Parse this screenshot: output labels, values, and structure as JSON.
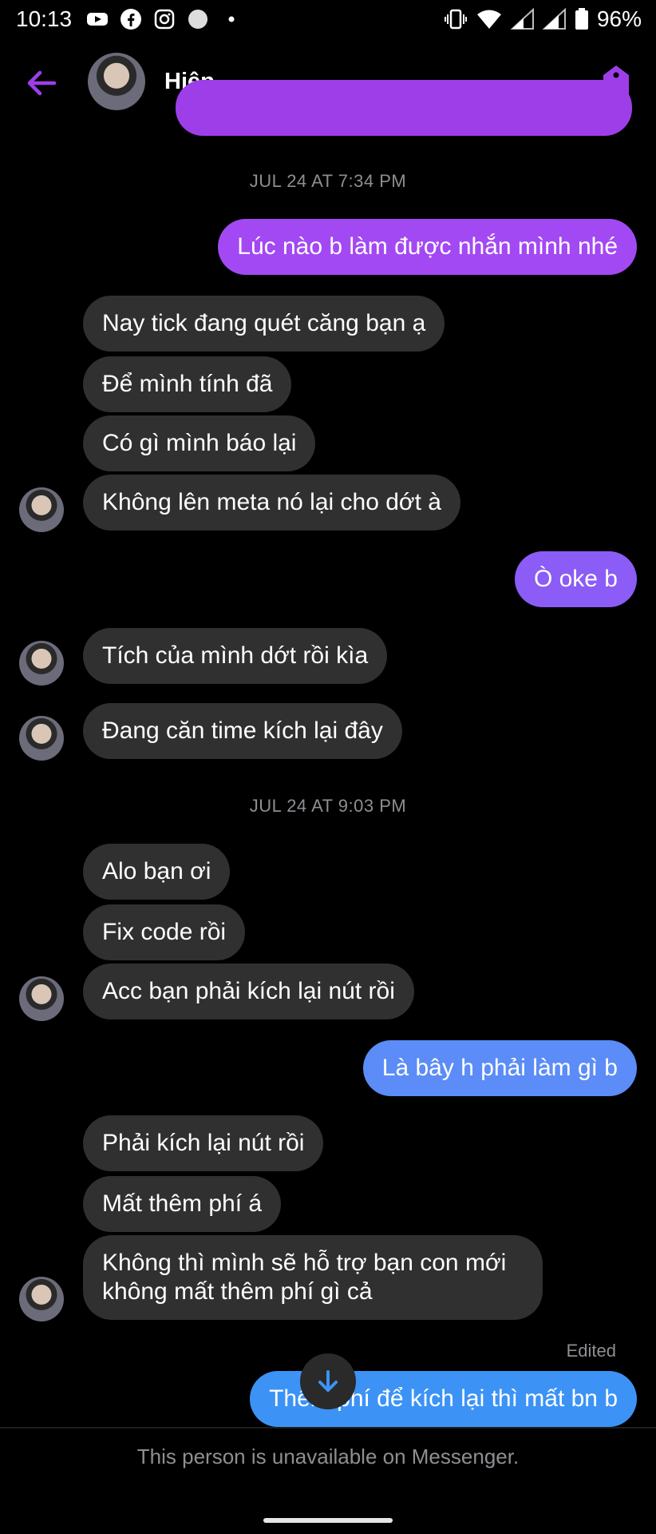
{
  "status_bar": {
    "time": "10:13",
    "battery": "96%",
    "app_icons": [
      "youtube-icon",
      "facebook-icon",
      "instagram-icon",
      "circle-icon",
      "dot-icon"
    ],
    "system_icons": [
      "vibrate-icon",
      "wifi-icon",
      "signal-icon",
      "signal-icon",
      "battery-icon"
    ]
  },
  "header": {
    "contact_name": "Hiệp",
    "accent_color": "#9e3ee9"
  },
  "conversation": {
    "timestamps": [
      "JUL 24 AT 7:34 PM",
      "JUL 24 AT 9:03 PM"
    ],
    "messages": [
      {
        "from": "me",
        "text": "Lúc nào b làm được nhắn mình nhé"
      },
      {
        "from": "them",
        "text": "Nay tick đang quét căng bạn ạ"
      },
      {
        "from": "them",
        "text": "Để mình tính đã"
      },
      {
        "from": "them",
        "text": "Có gì mình báo lại"
      },
      {
        "from": "them",
        "text": "Không lên meta nó lại cho dớt à"
      },
      {
        "from": "me",
        "text": "Ò oke b"
      },
      {
        "from": "them",
        "text": "Tích của mình dớt rồi kìa"
      },
      {
        "from": "them",
        "text": "Đang căn time kích lại đây"
      },
      {
        "from": "them",
        "text": "Alo bạn ơi"
      },
      {
        "from": "them",
        "text": "Fix code rồi"
      },
      {
        "from": "them",
        "text": "Acc bạn phải kích lại nút rồi"
      },
      {
        "from": "me",
        "text": "Là bây h phải làm gì b"
      },
      {
        "from": "them",
        "text": "Phải kích lại nút rồi"
      },
      {
        "from": "them",
        "text": "Mất thêm phí á"
      },
      {
        "from": "them",
        "text": "Không thì mình sẽ hỗ trợ bạn con mới không mất thêm phí gì cả"
      },
      {
        "from": "me",
        "text": "Thêm phí để kích lại thì mất bn b"
      }
    ],
    "edited_label": "Edited"
  },
  "footer": {
    "unavailable_text": "This person is unavailable on Messenger."
  },
  "colors": {
    "background": "#000000",
    "incoming_bubble": "#303030",
    "outgoing_purple": "#a349f3",
    "outgoing_blue": "#5b8cf7",
    "muted_text": "#8e8e93"
  }
}
